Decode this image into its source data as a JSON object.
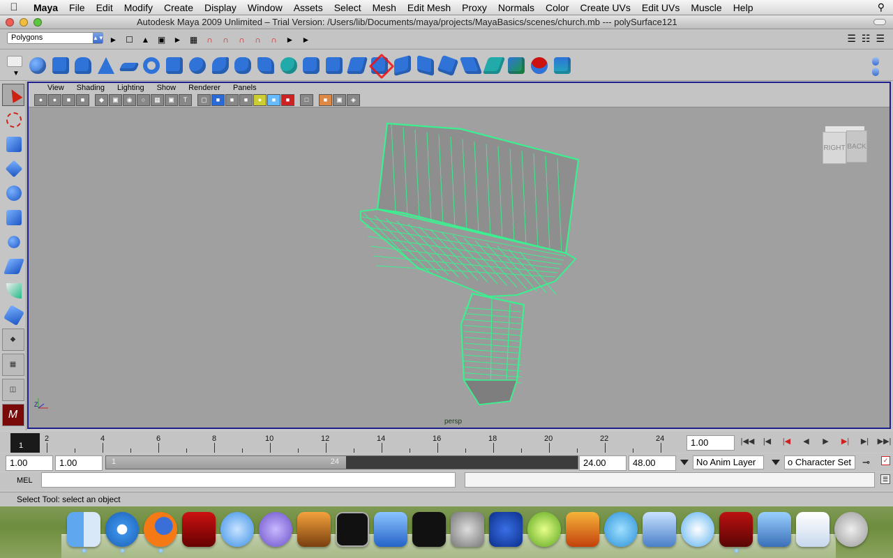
{
  "menubar": {
    "app": "Maya",
    "items": [
      "File",
      "Edit",
      "Modify",
      "Create",
      "Display",
      "Window",
      "Assets",
      "Select",
      "Mesh",
      "Edit Mesh",
      "Proxy",
      "Normals",
      "Color",
      "Create UVs",
      "Edit UVs",
      "Muscle",
      "Help"
    ]
  },
  "window": {
    "title": "Autodesk Maya 2009 Unlimited – Trial Version: /Users/lib/Documents/maya/projects/MayaBasics/scenes/church.mb   ---   polySurface121"
  },
  "statusline": {
    "menuset": "Polygons"
  },
  "panel": {
    "menus": [
      "View",
      "Shading",
      "Lighting",
      "Show",
      "Renderer",
      "Panels"
    ],
    "camera": "persp",
    "viewcube": {
      "front": "RIGHT",
      "side": "BACK"
    },
    "axis_label": "Z"
  },
  "timeline": {
    "current_frame": "1",
    "tick_labels": [
      "2",
      "4",
      "6",
      "8",
      "10",
      "12",
      "14",
      "16",
      "18",
      "20",
      "22",
      "24"
    ],
    "current_time_field": "1.00"
  },
  "range": {
    "start_time": "1.00",
    "playback_start": "1.00",
    "slider_start": "1",
    "slider_end": "24",
    "playback_end": "24.00",
    "end_time": "48.00",
    "anim_layer": "No Anim Layer",
    "character_set": "o Character Set"
  },
  "mel": {
    "label": "MEL"
  },
  "helpline": {
    "text": "Select Tool: select an object"
  },
  "colors": {
    "wireframe": "#3bf08f",
    "viewport_bg": "#a0a0a0",
    "viewport_border": "#1a1f8a"
  },
  "dock": {
    "icons": [
      "finder-icon",
      "safari-icon",
      "firefox-icon",
      "photo-booth-icon",
      "itunes-icon",
      "instruments-icon",
      "preview-icon",
      "terminal-icon",
      "word-icon",
      "xcode-icon",
      "system-preferences-icon",
      "frog-icon",
      "limewire-icon",
      "flash-icon",
      "messenger-icon",
      "mail-icon",
      "face-icon",
      "maya-icon",
      "iphoto-icon",
      "documents-icon",
      "trash-icon"
    ]
  }
}
